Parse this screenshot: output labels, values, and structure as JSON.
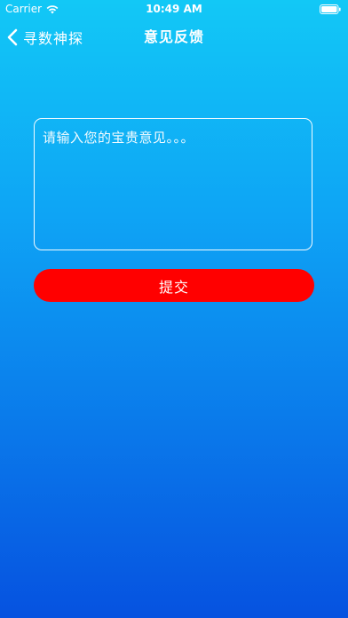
{
  "status_bar": {
    "carrier": "Carrier",
    "time": "10:49 AM",
    "wifi_icon": "wifi-icon",
    "battery_icon": "battery-full-icon"
  },
  "nav": {
    "back_label": "寻数神探",
    "back_icon": "chevron-left-icon",
    "title": "意见反馈"
  },
  "feedback": {
    "placeholder": "请输入您的宝贵意见。。。",
    "value": ""
  },
  "submit": {
    "label": "提交"
  },
  "colors": {
    "gradient_top": "#12c8f6",
    "gradient_bottom": "#0652e0",
    "submit_button": "#ff0000",
    "text": "#ffffff"
  }
}
